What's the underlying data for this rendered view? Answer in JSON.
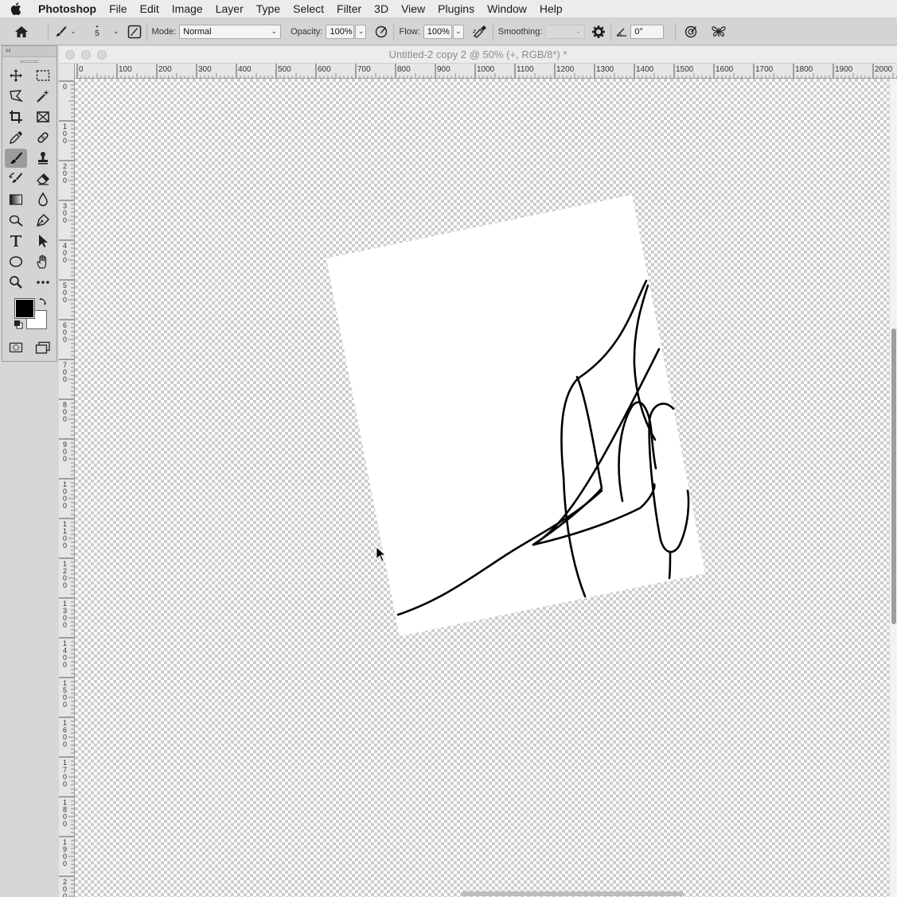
{
  "menubar": {
    "apple_icon": "apple-logo",
    "app_name": "Photoshop",
    "items": [
      "File",
      "Edit",
      "Image",
      "Layer",
      "Type",
      "Select",
      "Filter",
      "3D",
      "View",
      "Plugins",
      "Window",
      "Help"
    ]
  },
  "options_bar": {
    "brush_size": "5",
    "mode_label": "Mode:",
    "mode_value": "Normal",
    "opacity_label": "Opacity:",
    "opacity_value": "100%",
    "flow_label": "Flow:",
    "flow_value": "100%",
    "smoothing_label": "Smoothing:",
    "smoothing_value": "",
    "angle_value": "0°"
  },
  "document": {
    "title": "Untitled-2 copy 2 @ 50% (+, RGB/8*) *"
  },
  "rulers": {
    "horizontal_labels": [
      "0",
      "100",
      "200",
      "300",
      "400",
      "500",
      "600",
      "700",
      "800",
      "900",
      "1000",
      "1100",
      "1200",
      "1300",
      "1400",
      "1500",
      "1600",
      "1700",
      "1800",
      "1900",
      "2000"
    ],
    "vertical_labels": [
      "0",
      "100",
      "200",
      "300",
      "400",
      "500",
      "600",
      "700",
      "800",
      "900",
      "1000",
      "1100",
      "1200",
      "1300",
      "1400",
      "1500",
      "1600",
      "1700",
      "1800",
      "1900",
      "2000"
    ]
  },
  "colors": {
    "foreground": "#000000",
    "background": "#ffffff",
    "toolbar_bg": "#d4d4d4",
    "active_tool_bg": "#9c9c9c"
  },
  "tools": {
    "active": "brush-tool"
  }
}
